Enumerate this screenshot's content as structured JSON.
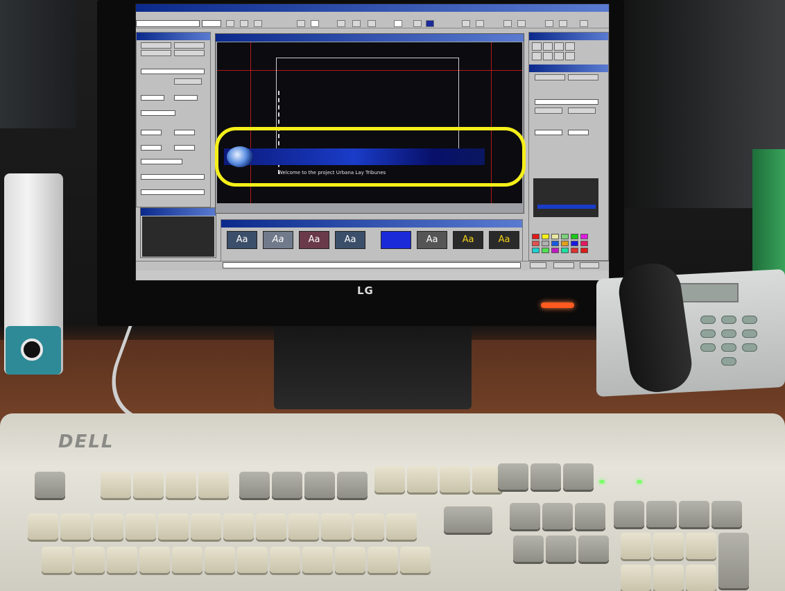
{
  "brand": {
    "monitor": "LG",
    "keyboard": "DELL"
  },
  "screen": {
    "ticker_text": "Welcome to the project Urbana Lay Tribunes"
  },
  "colors": {
    "highlight": "#f5ef1a",
    "banner_blue": "#1a3cc8",
    "titlebar": "#0b2a8c",
    "power_led": "#ff5a1f",
    "keyboard_led": "#7cff6a"
  },
  "presets": {
    "label": "Aa"
  },
  "icons": {
    "globe": "globe-icon"
  }
}
